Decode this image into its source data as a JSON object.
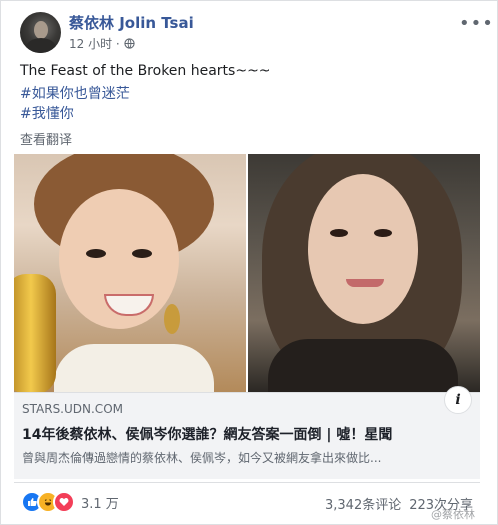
{
  "author": {
    "name": "蔡依林 Jolin Tsai"
  },
  "meta": {
    "time": "12 小时 ·",
    "privacy_icon": "globe-icon"
  },
  "menu": {
    "more_label": "•••"
  },
  "post": {
    "line1": "The Feast of the Broken hearts~~~",
    "tag1": "#如果你也曾迷茫",
    "tag2": "#我懂你",
    "see_translation": "查看翻译"
  },
  "link_preview": {
    "domain": "STARS.UDN.COM",
    "headline": "14年後蔡依林、侯佩岑你選誰？網友答案一面倒 | 噓！星聞",
    "snippet": "曾與周杰倫傳過戀情的蔡依林、侯佩岑，如今又被網友拿出來做比...",
    "info_icon": "i"
  },
  "reactions": {
    "icons": [
      "like-icon",
      "haha-icon",
      "love-icon"
    ],
    "count": "3.1 万"
  },
  "stats": {
    "comments": "3,342条评论",
    "shares": "223次分享"
  },
  "watermark": "@蔡依林"
}
